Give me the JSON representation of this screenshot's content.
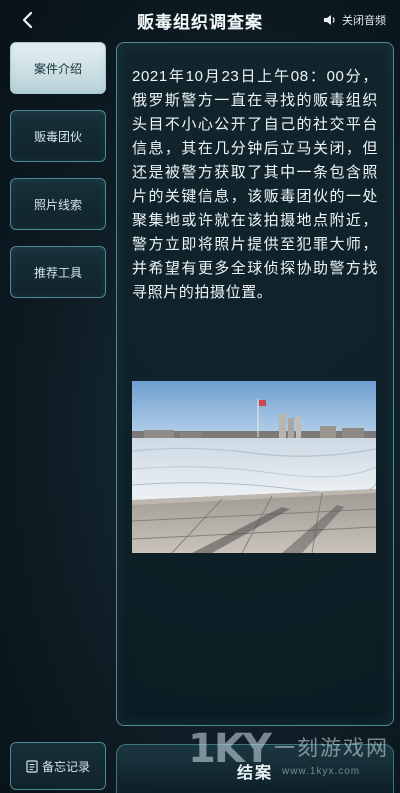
{
  "header": {
    "title": "贩毒组织调查案",
    "audio_label": "关闭音频"
  },
  "sidebar": {
    "items": [
      {
        "label": "案件介绍",
        "active": true
      },
      {
        "label": "贩毒团伙",
        "active": false
      },
      {
        "label": "照片线索",
        "active": false
      },
      {
        "label": "推荐工具",
        "active": false
      }
    ]
  },
  "content": {
    "case_text": "2021年10月23日上午08：00分，俄罗斯警方一直在寻找的贩毒组织头目不小心公开了自己的社交平台信息，其在几分钟后立马关闭，但还是被警方获取了其中一条包含照片的关键信息，该贩毒团伙的一处聚集地或许就在该拍摄地点附近，警方立即将照片提供至犯罪大师，并希望有更多全球侦探协助警方找寻照片的拍摄位置。"
  },
  "footer": {
    "memo_label": "备忘记录",
    "close_case_label": "结案"
  },
  "watermark": {
    "logo": "1KY",
    "name": "一刻游戏网",
    "url": "www.1kyx.com"
  },
  "icons": {
    "back": "back-arrow-icon",
    "audio": "speaker-icon",
    "memo": "notebook-icon"
  },
  "colors": {
    "background": "#0e1c24",
    "border": "#4f8794",
    "active_tab": "#d6e8ec"
  }
}
